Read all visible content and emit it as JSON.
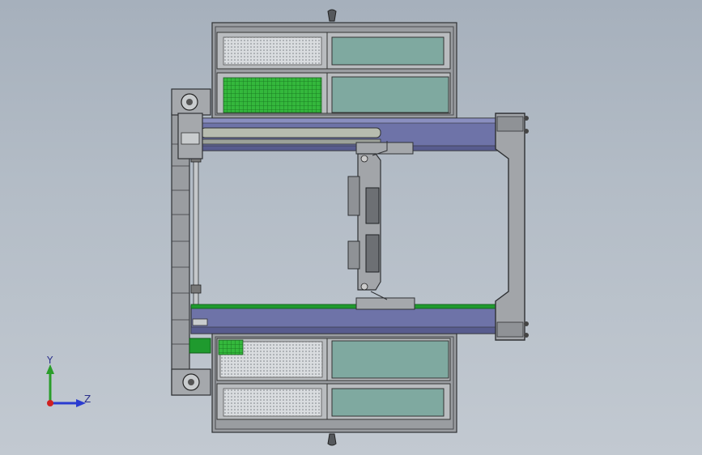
{
  "viewport": {
    "background_top": "#a6b0bc",
    "background_bottom": "#c2c9d1"
  },
  "colors": {
    "frame_gray": "#8f9296",
    "frame_dark": "#3a3c40",
    "rail_blue": "#6e73a8",
    "rail_green": "#1f9a2e",
    "glass_teal": "#7fa9a0",
    "perforated": "#cfd3d6",
    "mesh_green": "#2fb336"
  },
  "triad": {
    "y_label": "Y",
    "z_label": "Z",
    "y_color": "#2a9d2a",
    "z_color": "#2a3bd0",
    "x_color": "#d02020"
  }
}
